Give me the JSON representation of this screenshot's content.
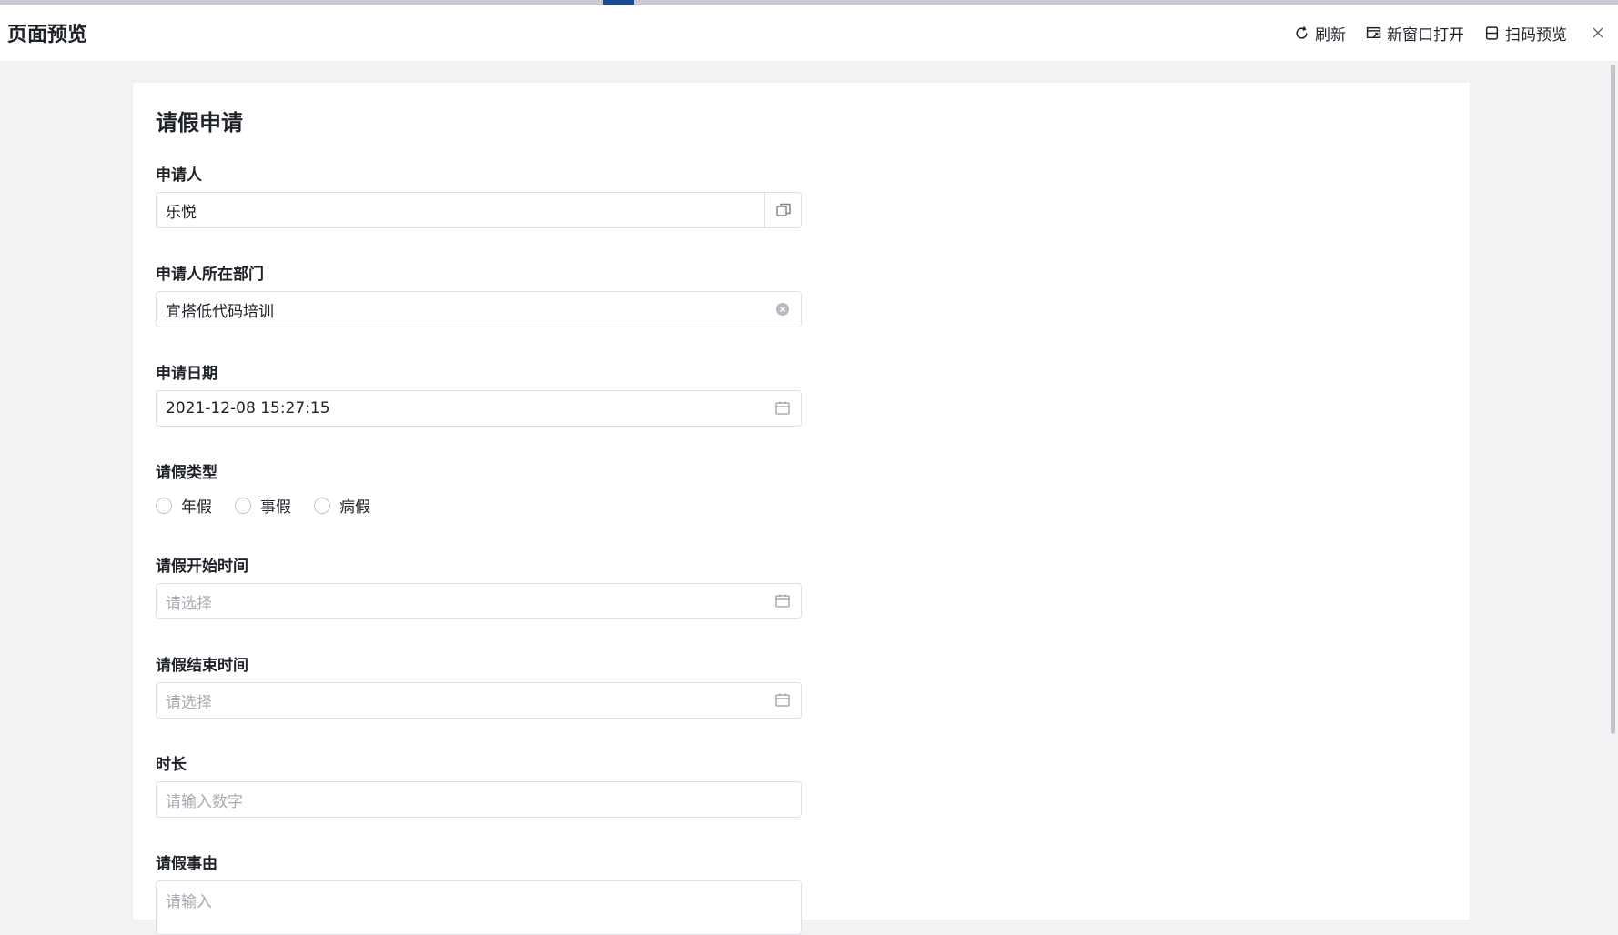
{
  "window": {
    "title": "页面预览",
    "toolbar": {
      "refresh_label": "刷新",
      "new_window_label": "新窗口打开",
      "scan_preview_label": "扫码预览"
    }
  },
  "form": {
    "title": "请假申请",
    "fields": {
      "applicant": {
        "label": "申请人",
        "value": "乐悦"
      },
      "department": {
        "label": "申请人所在部门",
        "value": "宜搭低代码培训"
      },
      "apply_date": {
        "label": "申请日期",
        "value": "2021-12-08 15:27:15"
      },
      "leave_type": {
        "label": "请假类型",
        "options": [
          "年假",
          "事假",
          "病假"
        ],
        "selected": null
      },
      "start_time": {
        "label": "请假开始时间",
        "placeholder": "请选择"
      },
      "end_time": {
        "label": "请假结束时间",
        "placeholder": "请选择"
      },
      "duration": {
        "label": "时长",
        "placeholder": "请输入数字"
      },
      "reason": {
        "label": "请假事由",
        "placeholder": "请输入"
      }
    }
  },
  "colors": {
    "accent": "#1e4b8f",
    "border": "#dfe1e5",
    "placeholder": "#a8abb2",
    "text": "#1f2329",
    "page_bg": "#f1f2f4"
  },
  "icons": {
    "refresh": "refresh-icon",
    "new_window": "new-window-icon",
    "scan": "scan-icon",
    "close": "close-icon",
    "copy": "copy-icon",
    "clear": "clear-icon",
    "calendar": "calendar-icon"
  }
}
